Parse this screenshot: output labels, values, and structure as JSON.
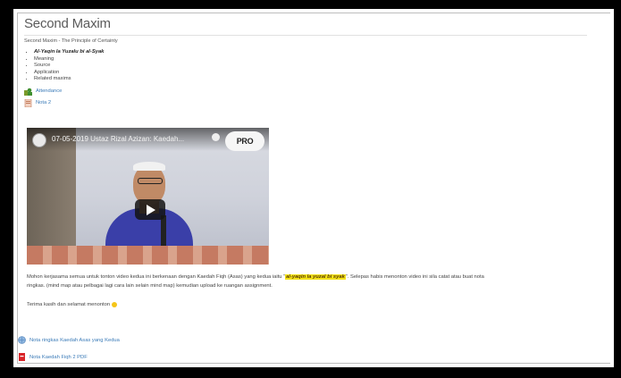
{
  "page": {
    "title": "Second Maxim",
    "subtitle": "Second Maxim - The Principle of Certainty"
  },
  "topics": [
    "Al-Yaqin la Yuzalu bi al-Syak",
    "Meaning",
    "Source",
    "Application",
    "Related maxims"
  ],
  "resources": {
    "attendance": "Attendance",
    "nota2": "Nota 2",
    "nota_ringkas": "Nota ringkas Kaedah Asas yang Kedua",
    "nota_pdf": "Nota Kaedah Fiqh 2 PDF"
  },
  "video": {
    "title": "07-05-2019 Ustaz Rizal Azizan: Kaedah...",
    "channel_logo": "PRO",
    "icons": {
      "play": "play-icon",
      "channel": "channel-avatar-icon",
      "watch_later": "clock-icon"
    }
  },
  "body": {
    "pre": "Mohon kerjasama semua untuk tonton video kedua ini berkenaan dengan Kaedah Fiqh (Asas) yang kedua iaitu “",
    "highlight": "al-yaqin la yuzal bi syak",
    "post": "”. Selepas habis menonton video ini sila catat atau buat nota",
    "line2": "ringkas. (mind map atau pelbagai lagi cara lain selain mind map) kemudian upload ke ruangan assignment."
  },
  "thanks": "Terima kasih dan selamat menonton",
  "colors": {
    "link": "#3b7bb8",
    "highlight": "#f3e21a",
    "frame": "#000000"
  }
}
